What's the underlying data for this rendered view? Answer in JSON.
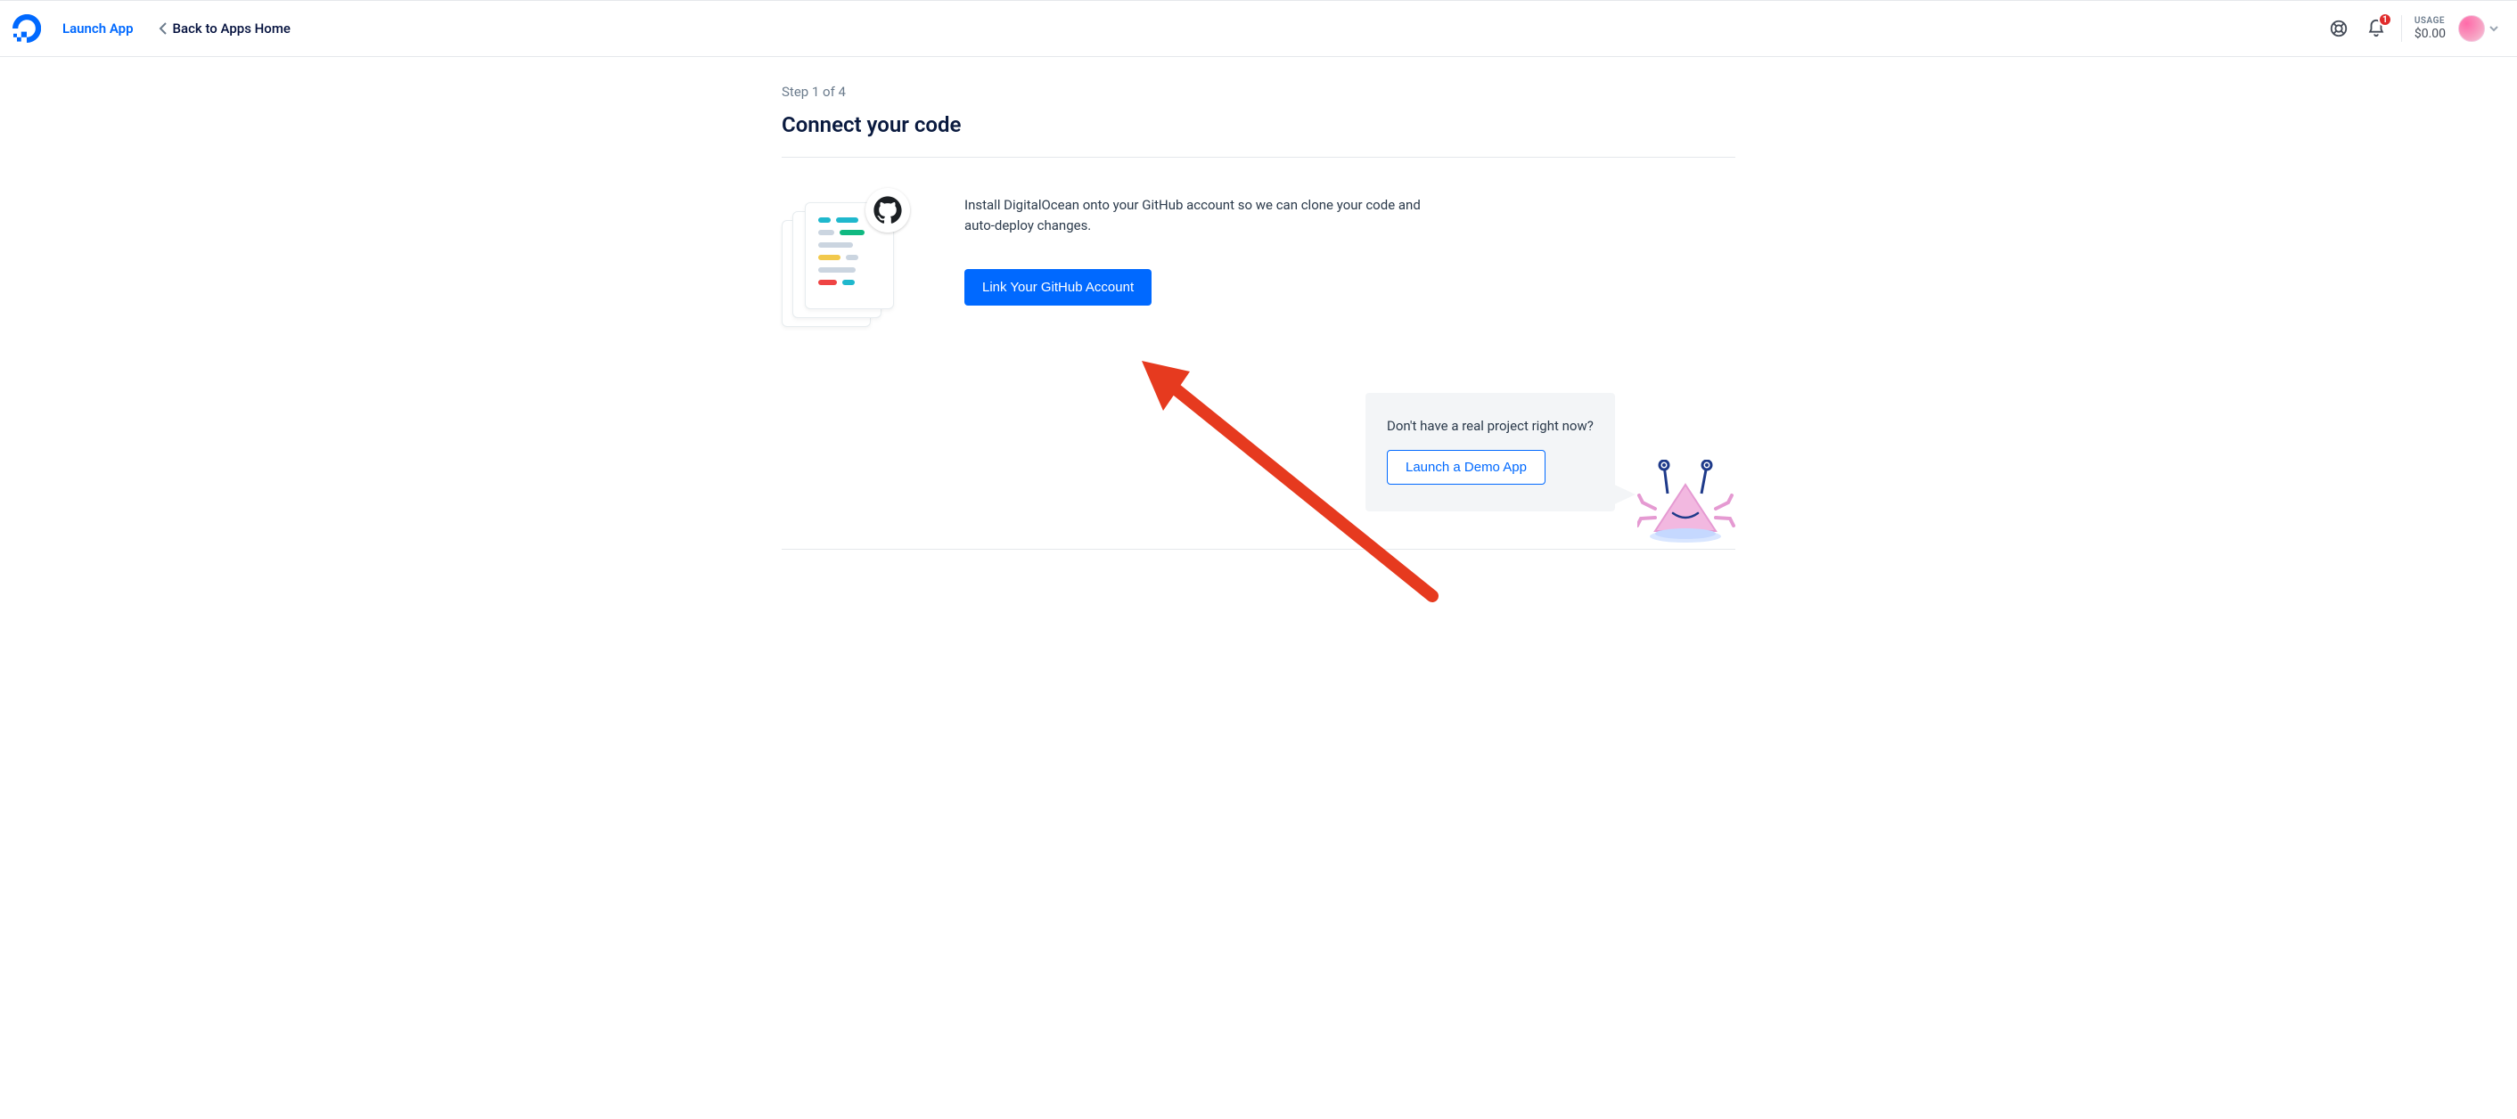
{
  "header": {
    "launch_label": "Launch App",
    "back_label": "Back to Apps Home",
    "notifications_count": "1",
    "usage_label": "USAGE",
    "usage_value": "$0.00"
  },
  "wizard": {
    "step_label": "Step 1 of 4",
    "title": "Connect your code",
    "body": "Install DigitalOcean onto your GitHub account so we can clone your code and auto-deploy changes.",
    "link_github_label": "Link Your GitHub Account"
  },
  "demo_card": {
    "prompt": "Don't have a real project right now?",
    "cta": "Launch a Demo App"
  }
}
